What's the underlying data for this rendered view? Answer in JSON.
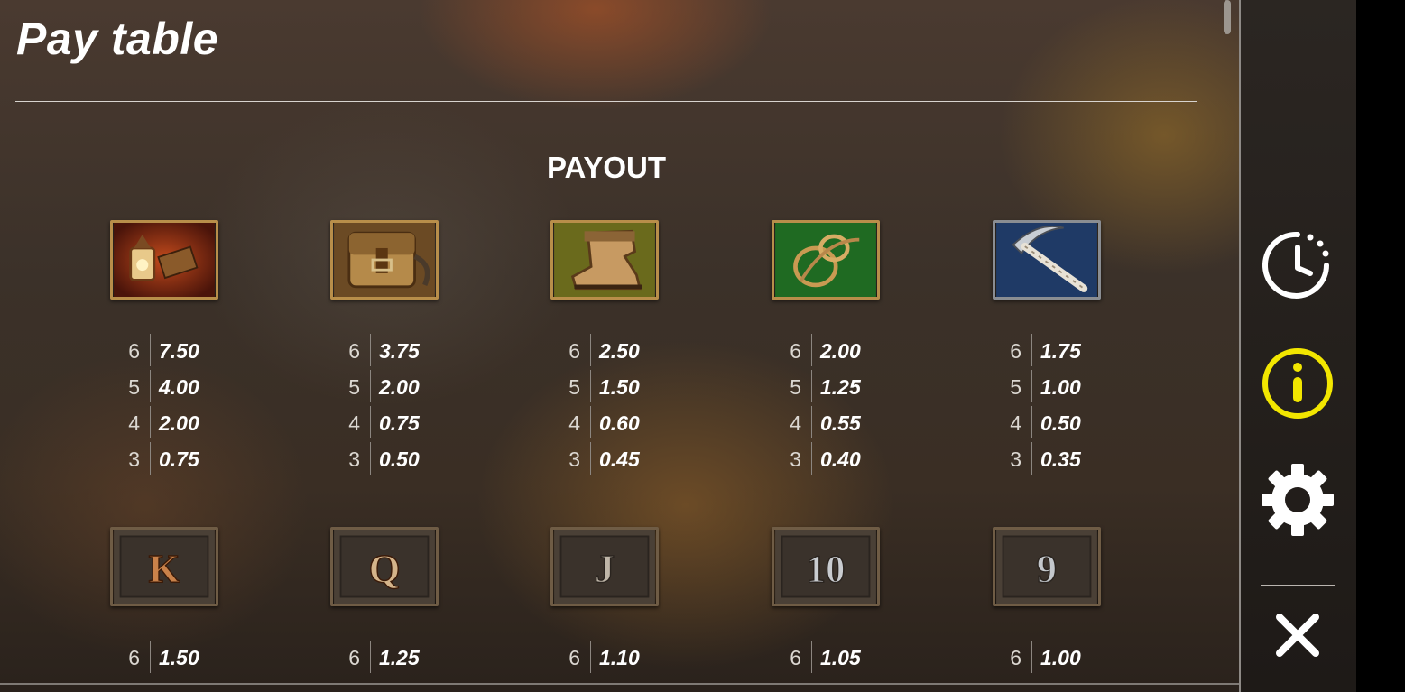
{
  "header": {
    "title": "Pay table"
  },
  "main": {
    "heading": "PAYOUT",
    "symbols": [
      {
        "name": "lantern",
        "payouts": [
          {
            "count": "6",
            "value": "7.50"
          },
          {
            "count": "5",
            "value": "4.00"
          },
          {
            "count": "4",
            "value": "2.00"
          },
          {
            "count": "3",
            "value": "0.75"
          }
        ]
      },
      {
        "name": "backpack",
        "payouts": [
          {
            "count": "6",
            "value": "3.75"
          },
          {
            "count": "5",
            "value": "2.00"
          },
          {
            "count": "4",
            "value": "0.75"
          },
          {
            "count": "3",
            "value": "0.50"
          }
        ]
      },
      {
        "name": "boot",
        "payouts": [
          {
            "count": "6",
            "value": "2.50"
          },
          {
            "count": "5",
            "value": "1.50"
          },
          {
            "count": "4",
            "value": "0.60"
          },
          {
            "count": "3",
            "value": "0.45"
          }
        ]
      },
      {
        "name": "rope",
        "payouts": [
          {
            "count": "6",
            "value": "2.00"
          },
          {
            "count": "5",
            "value": "1.25"
          },
          {
            "count": "4",
            "value": "0.55"
          },
          {
            "count": "3",
            "value": "0.40"
          }
        ]
      },
      {
        "name": "pickaxe",
        "payouts": [
          {
            "count": "6",
            "value": "1.75"
          },
          {
            "count": "5",
            "value": "1.00"
          },
          {
            "count": "4",
            "value": "0.50"
          },
          {
            "count": "3",
            "value": "0.35"
          }
        ]
      },
      {
        "name": "K",
        "letter": "K",
        "payouts": [
          {
            "count": "6",
            "value": "1.50"
          }
        ]
      },
      {
        "name": "Q",
        "letter": "Q",
        "payouts": [
          {
            "count": "6",
            "value": "1.25"
          }
        ]
      },
      {
        "name": "J",
        "letter": "J",
        "payouts": [
          {
            "count": "6",
            "value": "1.10"
          }
        ]
      },
      {
        "name": "10",
        "letter": "10",
        "payouts": [
          {
            "count": "6",
            "value": "1.05"
          }
        ]
      },
      {
        "name": "9",
        "letter": "9",
        "payouts": [
          {
            "count": "6",
            "value": "1.00"
          }
        ]
      }
    ]
  },
  "sidebar": {
    "buttons": [
      {
        "icon": "history-clock-icon",
        "color": "#ffffff"
      },
      {
        "icon": "info-icon",
        "color": "#f2e600"
      },
      {
        "icon": "gear-icon",
        "color": "#ffffff"
      },
      {
        "icon": "close-icon",
        "color": "#ffffff"
      }
    ]
  },
  "colors": {
    "active": "#f2e600",
    "frame_gold": "#b88e4a",
    "text": "#ffffff"
  }
}
